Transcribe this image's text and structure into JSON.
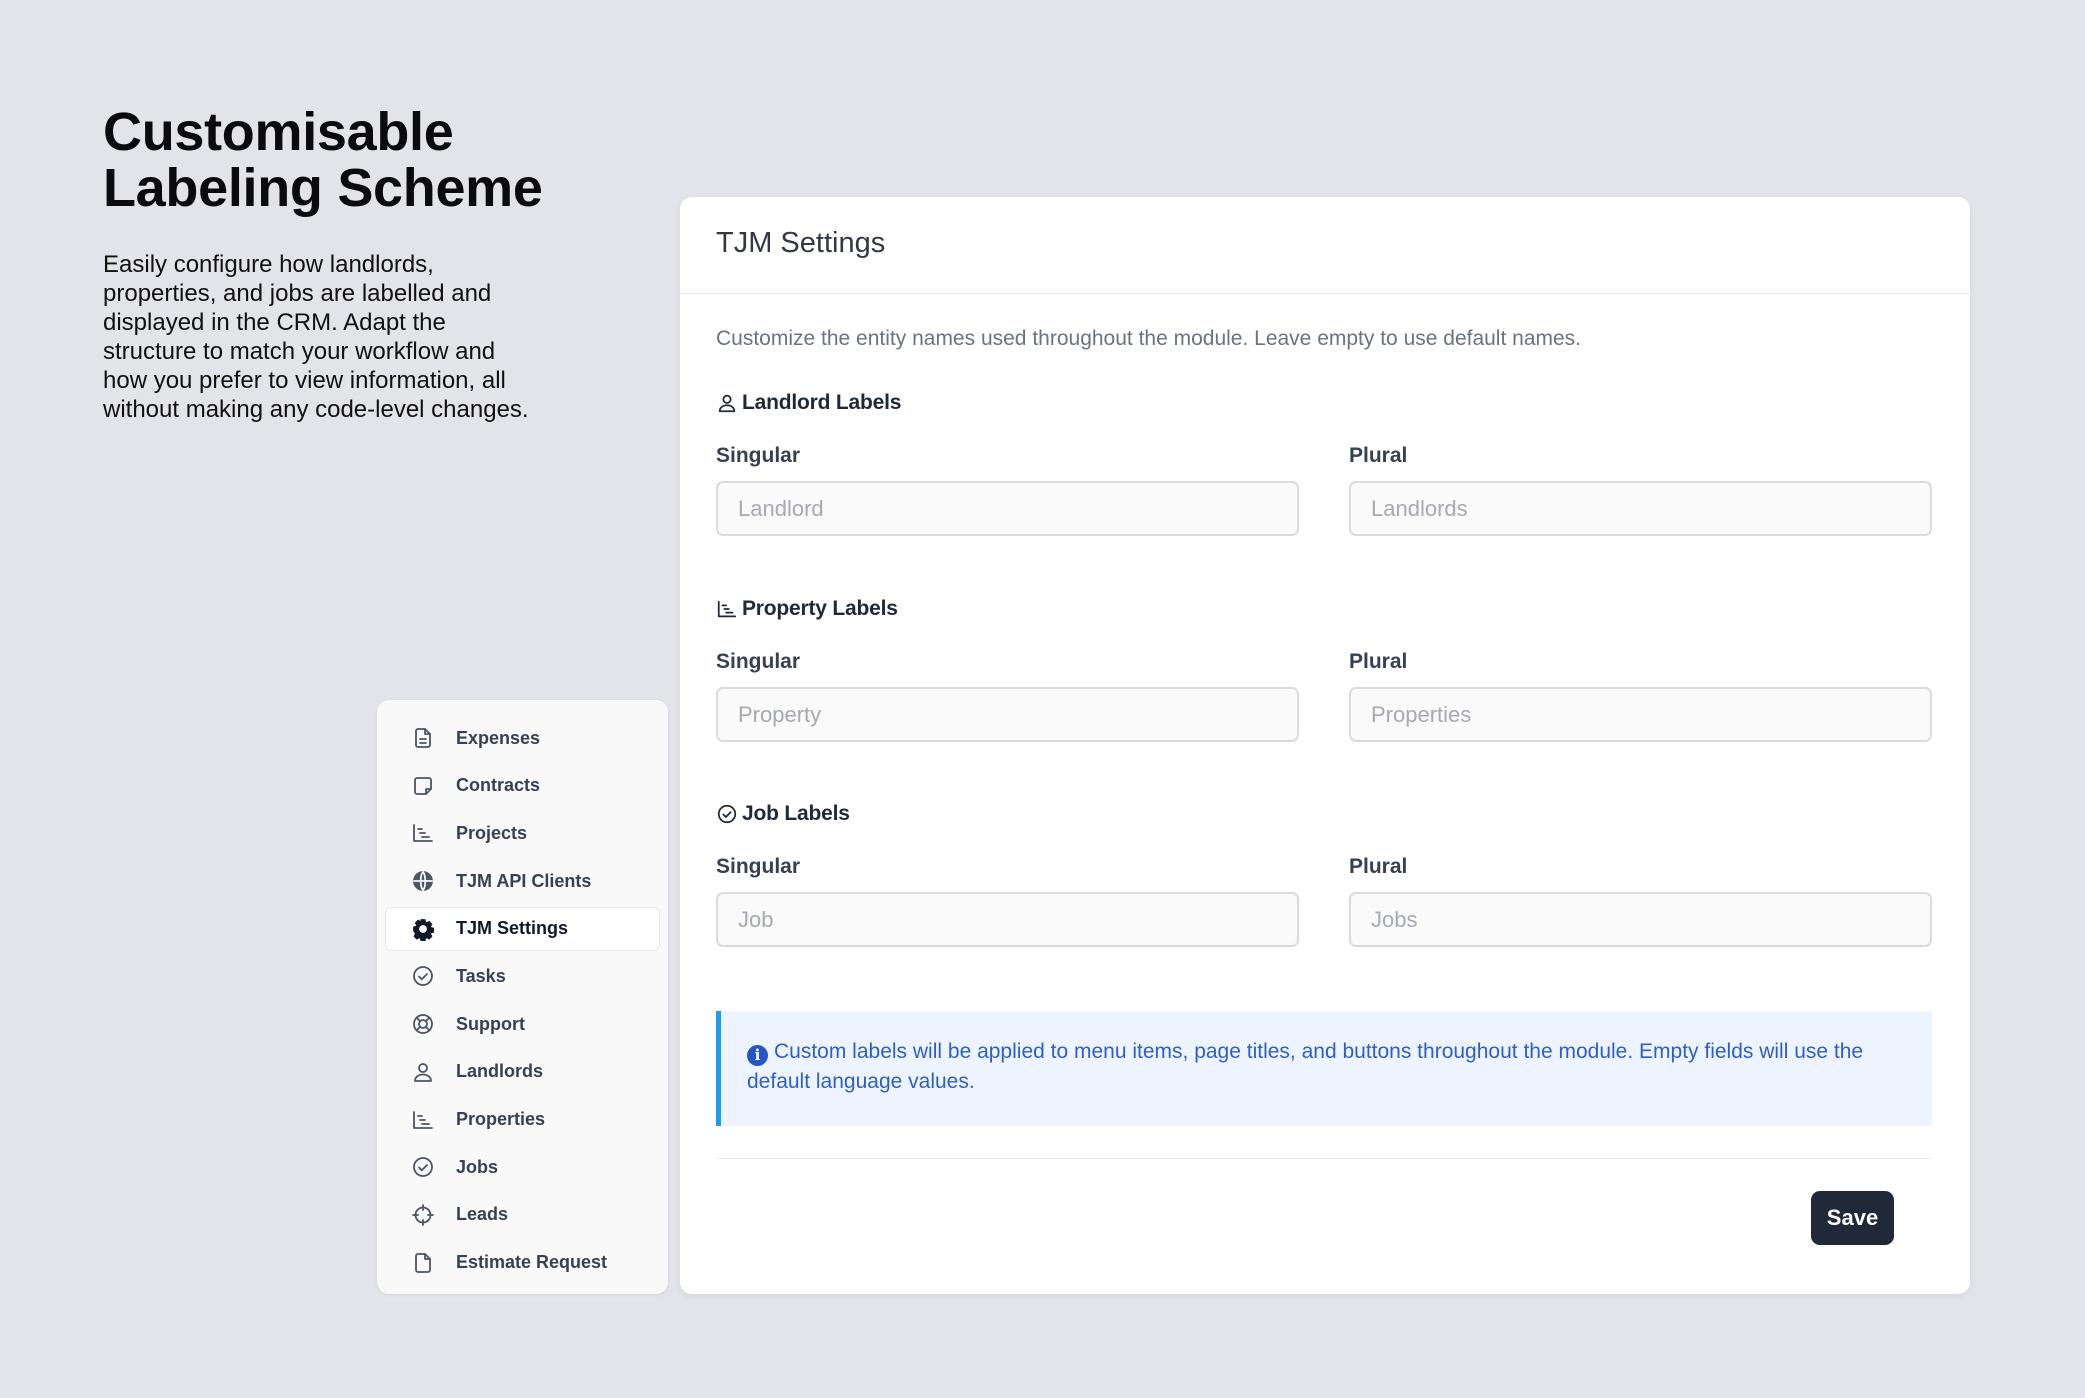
{
  "promo": {
    "title_line1": "Customisable",
    "title_line2": "Labeling Scheme",
    "body": "Easily configure how landlords, properties, and jobs are labelled and displayed in the CRM. Adapt the structure to match your workflow and how you prefer to view information, all without making any code-level changes."
  },
  "menu": {
    "items": [
      {
        "label": "Expenses",
        "icon": "file-text-icon"
      },
      {
        "label": "Contracts",
        "icon": "sticky-note-icon"
      },
      {
        "label": "Projects",
        "icon": "gantt-chart-icon"
      },
      {
        "label": "TJM API Clients",
        "icon": "globe-icon"
      },
      {
        "label": "TJM Settings",
        "icon": "gear-icon",
        "active": true
      },
      {
        "label": "Tasks",
        "icon": "check-circle-icon"
      },
      {
        "label": "Support",
        "icon": "life-ring-icon"
      },
      {
        "label": "Landlords",
        "icon": "user-icon"
      },
      {
        "label": "Properties",
        "icon": "gantt-chart-icon"
      },
      {
        "label": "Jobs",
        "icon": "check-circle-icon"
      },
      {
        "label": "Leads",
        "icon": "crosshair-icon"
      },
      {
        "label": "Estimate Request",
        "icon": "file-icon"
      }
    ]
  },
  "settings": {
    "title": "TJM Settings",
    "description": "Customize the entity names used throughout the module. Leave empty to use default names.",
    "sections": {
      "landlord": {
        "title": "Landlord Labels",
        "singular_label": "Singular",
        "plural_label": "Plural",
        "singular_placeholder": "Landlord",
        "plural_placeholder": "Landlords",
        "singular_value": "",
        "plural_value": ""
      },
      "property": {
        "title": "Property Labels",
        "singular_label": "Singular",
        "plural_label": "Plural",
        "singular_placeholder": "Property",
        "plural_placeholder": "Properties",
        "singular_value": "",
        "plural_value": ""
      },
      "job": {
        "title": "Job Labels",
        "singular_label": "Singular",
        "plural_label": "Plural",
        "singular_placeholder": "Job",
        "plural_placeholder": "Jobs",
        "singular_value": "",
        "plural_value": ""
      }
    },
    "info_icon": "i",
    "info_text": "Custom labels will be applied to menu items, page titles, and buttons throughout the module. Empty fields will use the default language values.",
    "save_label": "Save"
  },
  "colors": {
    "background": "#e3e3ea",
    "primary_button": "#1f2937",
    "info_bg": "#eef4ff",
    "info_border": "#1e9bea",
    "info_text": "#2f5fc4"
  }
}
